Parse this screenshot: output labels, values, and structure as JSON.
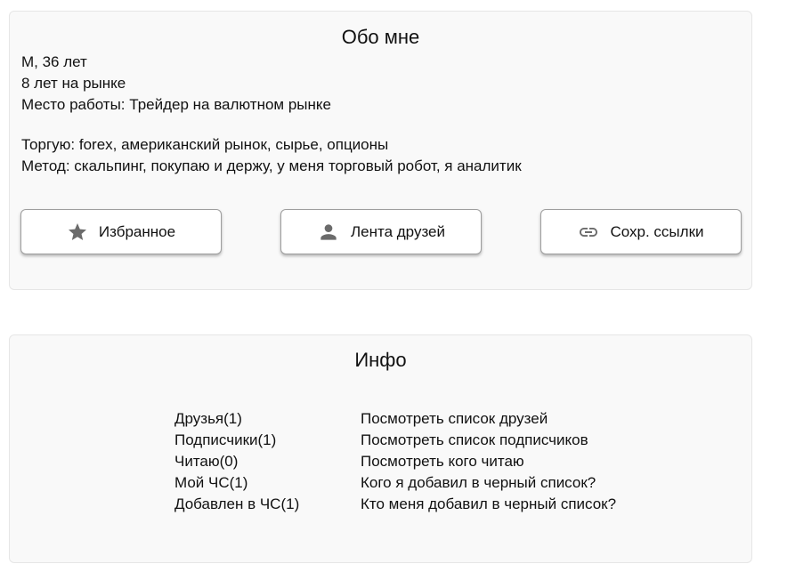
{
  "about": {
    "title": "Обо мне",
    "gender_age": "М, 36 лет",
    "experience": "8 лет на рынке",
    "workplace": "Место работы: Трейдер на валютном рынке",
    "trading": "Торгую: forex, американский рынок, сырье, опционы",
    "method": "Метод: скальпинг, покупаю и держу, у меня торговый робот, я аналитик",
    "buttons": {
      "favorites": {
        "label": "Избранное",
        "icon": "star-icon"
      },
      "friends_feed": {
        "label": "Лента друзей",
        "icon": "person-icon"
      },
      "saved_links": {
        "label": "Сохр. ссылки",
        "icon": "link-icon"
      }
    }
  },
  "info": {
    "title": "Инфо",
    "rows": [
      {
        "label": "Друзья(1)",
        "link": "Посмотреть список друзей"
      },
      {
        "label": "Подписчики(1)",
        "link": "Посмотреть список подписчиков"
      },
      {
        "label": "Читаю(0)",
        "link": "Посмотреть кого читаю"
      },
      {
        "label": "Мой ЧС(1)",
        "link": "Кого я добавил в черный список?"
      },
      {
        "label": "Добавлен в ЧС(1)",
        "link": "Кто меня добавил в черный список?"
      }
    ]
  },
  "colors": {
    "card_bg": "#f9f9f9",
    "icon_gray": "#6b6b6b"
  }
}
